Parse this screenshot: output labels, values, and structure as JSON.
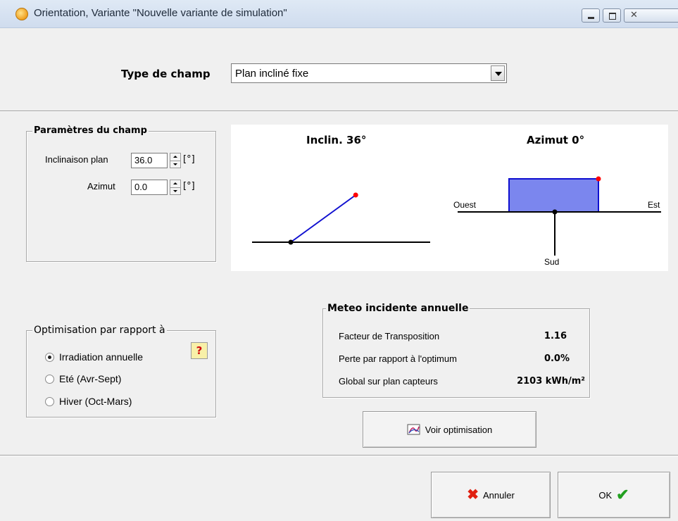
{
  "window": {
    "title": "Orientation, Variante \"Nouvelle variante de simulation\""
  },
  "field_type": {
    "label": "Type de champ",
    "selected": "Plan incliné fixe"
  },
  "params": {
    "title": "Paramètres du champ",
    "tilt_label": "Inclinaison plan",
    "tilt_value": "36.0",
    "tilt_unit": "[°]",
    "azimuth_label": "Azimut",
    "azimuth_value": "0.0",
    "azimuth_unit": "[°]"
  },
  "diagram": {
    "tilt_title": "Inclin. 36°",
    "azimuth_title": "Azimut 0°",
    "west": "Ouest",
    "east": "Est",
    "south": "Sud",
    "tilt_deg": 36,
    "azimuth_deg": 0
  },
  "optimisation": {
    "title": "Optimisation par rapport à",
    "options": [
      "Irradiation annuelle",
      "Eté (Avr-Sept)",
      "Hiver (Oct-Mars)"
    ],
    "selected_index": 0,
    "help": "?"
  },
  "meteo": {
    "title": "Meteo incidente annuelle",
    "rows": [
      {
        "label": "Facteur de Transposition",
        "value": "1.16"
      },
      {
        "label": "Perte par rapport à l'optimum",
        "value": "0.0%"
      },
      {
        "label": "Global sur plan capteurs",
        "value": "2103 kWh/m²"
      }
    ]
  },
  "buttons": {
    "view_optimisation": "Voir optimisation",
    "cancel": "Annuler",
    "ok": "OK"
  },
  "colors": {
    "plane_line": "#1010d0",
    "plane_fill": "#7b86ee",
    "marker": "#ff0000"
  }
}
